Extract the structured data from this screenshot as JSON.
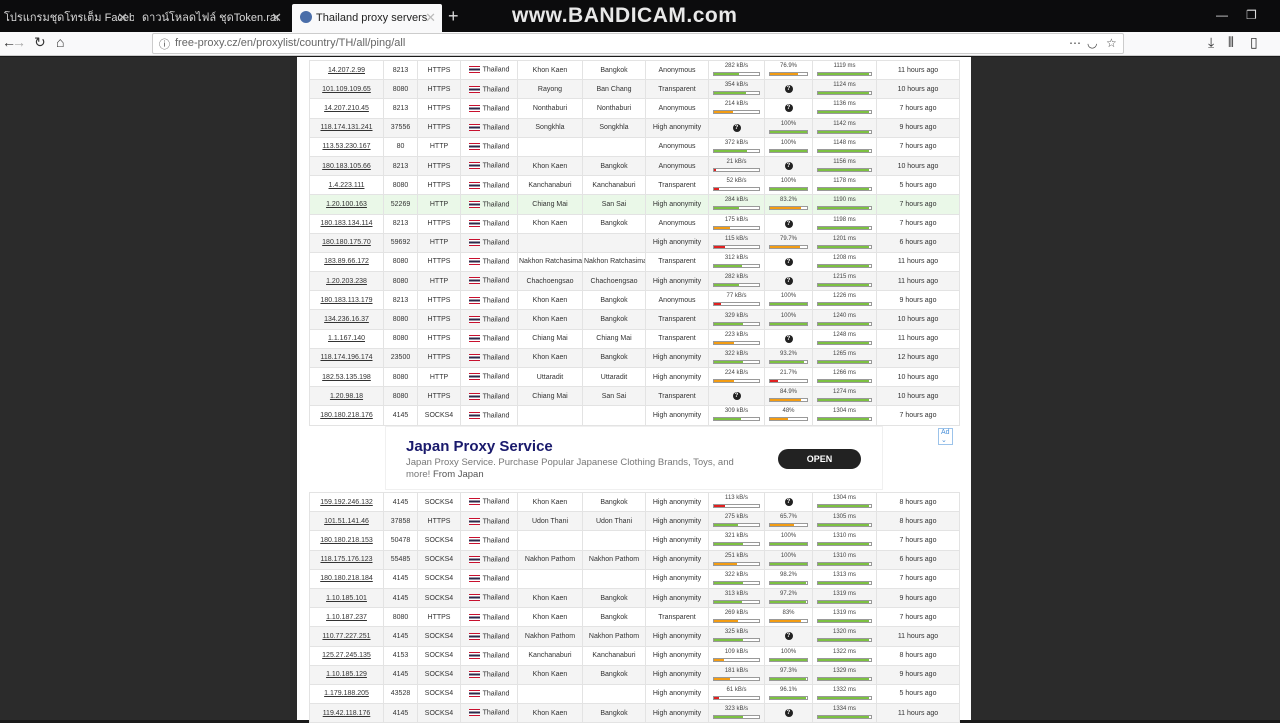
{
  "tabs": [
    {
      "label": "โปรแกรมชุดโทรเต็ม Facebook"
    },
    {
      "label": "ดาวน์โหลดไฟล์ ชุดToken.rar"
    },
    {
      "label": "Thailand proxy servers"
    }
  ],
  "watermark": "www.BANDICAM.com",
  "address_bar": {
    "url": "free-proxy.cz/en/proxylist/country/TH/all/ping/all"
  },
  "colors": {
    "green": "#7cc142",
    "orange": "#f39c12",
    "red": "#e02020"
  },
  "proxies_top": [
    {
      "ip": "14.207.2.99",
      "port": "8213",
      "protocol": "HTTPS",
      "country": "Thailand",
      "region": "Khon Kaen",
      "city": "Bangkok",
      "anonymity": "Anonymous",
      "speed": "282 kB/s",
      "speed_frac": 0.55,
      "speed_col": "green",
      "uptime": "76.9%",
      "uptime_frac": 0.77,
      "uptime_col": "orange",
      "response": "1119 ms",
      "checked": "11 hours ago"
    },
    {
      "ip": "101.109.109.65",
      "port": "8080",
      "protocol": "HTTPS",
      "country": "Thailand",
      "region": "Rayong",
      "city": "Ban Chang",
      "anonymity": "Transparent",
      "speed": "354 kB/s",
      "speed_frac": 0.7,
      "speed_col": "green",
      "uptime": "?",
      "response": "1124 ms",
      "checked": "10 hours ago"
    },
    {
      "ip": "14.207.210.45",
      "port": "8213",
      "protocol": "HTTPS",
      "country": "Thailand",
      "region": "Nonthaburi",
      "city": "Nonthaburi",
      "anonymity": "Anonymous",
      "speed": "214 kB/s",
      "speed_frac": 0.42,
      "speed_col": "orange",
      "uptime": "?",
      "response": "1136 ms",
      "checked": "7 hours ago"
    },
    {
      "ip": "118.174.131.241",
      "port": "37556",
      "protocol": "HTTPS",
      "country": "Thailand",
      "region": "Songkhla",
      "city": "Songkhla",
      "anonymity": "High anonymity",
      "speed": "?",
      "uptime": "100%",
      "uptime_frac": 1,
      "uptime_col": "green",
      "response": "1142 ms",
      "checked": "9 hours ago"
    },
    {
      "ip": "113.53.230.167",
      "port": "80",
      "protocol": "HTTP",
      "country": "Thailand",
      "region": "",
      "city": "",
      "anonymity": "Anonymous",
      "speed": "372 kB/s",
      "speed_frac": 0.74,
      "speed_col": "green",
      "uptime": "100%",
      "uptime_frac": 1,
      "uptime_col": "green",
      "response": "1148 ms",
      "checked": "7 hours ago"
    },
    {
      "ip": "180.183.105.66",
      "port": "8213",
      "protocol": "HTTPS",
      "country": "Thailand",
      "region": "Khon Kaen",
      "city": "Bangkok",
      "anonymity": "Anonymous",
      "speed": "21 kB/s",
      "speed_frac": 0.05,
      "speed_col": "red",
      "uptime": "?",
      "response": "1156 ms",
      "checked": "10 hours ago"
    },
    {
      "ip": "1.4.223.111",
      "port": "8080",
      "protocol": "HTTPS",
      "country": "Thailand",
      "region": "Kanchanaburi",
      "city": "Kanchanaburi",
      "anonymity": "Transparent",
      "speed": "52 kB/s",
      "speed_frac": 0.12,
      "speed_col": "red",
      "uptime": "100%",
      "uptime_frac": 1,
      "uptime_col": "green",
      "response": "1178 ms",
      "checked": "5 hours ago"
    },
    {
      "ip": "1.20.100.163",
      "port": "52269",
      "protocol": "HTTP",
      "country": "Thailand",
      "region": "Chiang Mai",
      "city": "San Sai",
      "anonymity": "High anonymity",
      "speed": "284 kB/s",
      "speed_frac": 0.56,
      "speed_col": "green",
      "uptime": "83.2%",
      "uptime_frac": 0.83,
      "uptime_col": "orange",
      "response": "1190 ms",
      "checked": "7 hours ago",
      "highlight": true
    },
    {
      "ip": "180.183.134.114",
      "port": "8213",
      "protocol": "HTTPS",
      "country": "Thailand",
      "region": "Khon Kaen",
      "city": "Bangkok",
      "anonymity": "Anonymous",
      "speed": "175 kB/s",
      "speed_frac": 0.35,
      "speed_col": "orange",
      "uptime": "?",
      "response": "1198 ms",
      "checked": "7 hours ago"
    },
    {
      "ip": "180.180.175.70",
      "port": "59692",
      "protocol": "HTTP",
      "country": "Thailand",
      "region": "",
      "city": "",
      "anonymity": "High anonymity",
      "speed": "115 kB/s",
      "speed_frac": 0.25,
      "speed_col": "red",
      "uptime": "79.7%",
      "uptime_frac": 0.8,
      "uptime_col": "orange",
      "response": "1201 ms",
      "checked": "6 hours ago"
    },
    {
      "ip": "183.89.66.172",
      "port": "8080",
      "protocol": "HTTPS",
      "country": "Thailand",
      "region": "Nakhon Ratchasima",
      "city": "Nakhon Ratchasima",
      "anonymity": "Transparent",
      "speed": "312 kB/s",
      "speed_frac": 0.62,
      "speed_col": "green",
      "uptime": "?",
      "response": "1208 ms",
      "checked": "11 hours ago"
    },
    {
      "ip": "1.20.203.238",
      "port": "8080",
      "protocol": "HTTP",
      "country": "Thailand",
      "region": "Chachoengsao",
      "city": "Chachoengsao",
      "anonymity": "High anonymity",
      "speed": "282 kB/s",
      "speed_frac": 0.55,
      "speed_col": "green",
      "uptime": "?",
      "response": "1215 ms",
      "checked": "11 hours ago"
    },
    {
      "ip": "180.183.113.179",
      "port": "8213",
      "protocol": "HTTPS",
      "country": "Thailand",
      "region": "Khon Kaen",
      "city": "Bangkok",
      "anonymity": "Anonymous",
      "speed": "77 kB/s",
      "speed_frac": 0.15,
      "speed_col": "red",
      "uptime": "100%",
      "uptime_frac": 1,
      "uptime_col": "green",
      "response": "1226 ms",
      "checked": "9 hours ago"
    },
    {
      "ip": "134.236.16.37",
      "port": "8080",
      "protocol": "HTTPS",
      "country": "Thailand",
      "region": "Khon Kaen",
      "city": "Bangkok",
      "anonymity": "Transparent",
      "speed": "329 kB/s",
      "speed_frac": 0.65,
      "speed_col": "green",
      "uptime": "100%",
      "uptime_frac": 1,
      "uptime_col": "green",
      "response": "1240 ms",
      "checked": "10 hours ago"
    },
    {
      "ip": "1.1.167.140",
      "port": "8080",
      "protocol": "HTTPS",
      "country": "Thailand",
      "region": "Chiang Mai",
      "city": "Chiang Mai",
      "anonymity": "Transparent",
      "speed": "223 kB/s",
      "speed_frac": 0.44,
      "speed_col": "orange",
      "uptime": "?",
      "response": "1248 ms",
      "checked": "11 hours ago"
    },
    {
      "ip": "118.174.196.174",
      "port": "23500",
      "protocol": "HTTPS",
      "country": "Thailand",
      "region": "Khon Kaen",
      "city": "Bangkok",
      "anonymity": "High anonymity",
      "speed": "322 kB/s",
      "speed_frac": 0.64,
      "speed_col": "green",
      "uptime": "93.2%",
      "uptime_frac": 0.93,
      "uptime_col": "green",
      "response": "1265 ms",
      "checked": "12 hours ago"
    },
    {
      "ip": "182.53.135.198",
      "port": "8080",
      "protocol": "HTTP",
      "country": "Thailand",
      "region": "Uttaradit",
      "city": "Uttaradit",
      "anonymity": "High anonymity",
      "speed": "224 kB/s",
      "speed_frac": 0.44,
      "speed_col": "orange",
      "uptime": "21.7%",
      "uptime_frac": 0.22,
      "uptime_col": "red",
      "response": "1266 ms",
      "checked": "10 hours ago"
    },
    {
      "ip": "1.20.98.18",
      "port": "8080",
      "protocol": "HTTPS",
      "country": "Thailand",
      "region": "Chiang Mai",
      "city": "San Sai",
      "anonymity": "Transparent",
      "speed": "?",
      "uptime": "84.9%",
      "uptime_frac": 0.85,
      "uptime_col": "orange",
      "response": "1274 ms",
      "checked": "10 hours ago"
    },
    {
      "ip": "180.180.218.176",
      "port": "4145",
      "protocol": "SOCKS4",
      "country": "Thailand",
      "region": "",
      "city": "",
      "anonymity": "High anonymity",
      "speed": "309 kB/s",
      "speed_frac": 0.61,
      "speed_col": "green",
      "uptime": "48%",
      "uptime_frac": 0.48,
      "uptime_col": "orange",
      "response": "1304 ms",
      "checked": "7 hours ago"
    }
  ],
  "ad": {
    "tag": "Ad ⌄",
    "title": "Japan Proxy Service",
    "desc": "Japan Proxy Service. Purchase Popular Japanese Clothing Brands, Toys, and more!",
    "source": "From Japan",
    "button": "OPEN"
  },
  "proxies_bottom": [
    {
      "ip": "159.192.246.132",
      "port": "4145",
      "protocol": "SOCKS4",
      "country": "Thailand",
      "region": "Khon Kaen",
      "city": "Bangkok",
      "anonymity": "High anonymity",
      "speed": "113 kB/s",
      "speed_frac": 0.24,
      "speed_col": "red",
      "uptime": "?",
      "response": "1304 ms",
      "checked": "8 hours ago"
    },
    {
      "ip": "101.51.141.46",
      "port": "37858",
      "protocol": "HTTPS",
      "country": "Thailand",
      "region": "Udon Thani",
      "city": "Udon Thani",
      "anonymity": "High anonymity",
      "speed": "275 kB/s",
      "speed_frac": 0.54,
      "speed_col": "green",
      "uptime": "65.7%",
      "uptime_frac": 0.66,
      "uptime_col": "orange",
      "response": "1305 ms",
      "checked": "8 hours ago"
    },
    {
      "ip": "180.180.218.153",
      "port": "50478",
      "protocol": "SOCKS4",
      "country": "Thailand",
      "region": "",
      "city": "",
      "anonymity": "High anonymity",
      "speed": "321 kB/s",
      "speed_frac": 0.64,
      "speed_col": "green",
      "uptime": "100%",
      "uptime_frac": 1,
      "uptime_col": "green",
      "response": "1310 ms",
      "checked": "7 hours ago"
    },
    {
      "ip": "118.175.176.123",
      "port": "55485",
      "protocol": "SOCKS4",
      "country": "Thailand",
      "region": "Nakhon Pathom",
      "city": "Nakhon Pathom",
      "anonymity": "High anonymity",
      "speed": "251 kB/s",
      "speed_frac": 0.5,
      "speed_col": "orange",
      "uptime": "100%",
      "uptime_frac": 1,
      "uptime_col": "green",
      "response": "1310 ms",
      "checked": "6 hours ago"
    },
    {
      "ip": "180.180.218.184",
      "port": "4145",
      "protocol": "SOCKS4",
      "country": "Thailand",
      "region": "",
      "city": "",
      "anonymity": "High anonymity",
      "speed": "322 kB/s",
      "speed_frac": 0.64,
      "speed_col": "green",
      "uptime": "98.2%",
      "uptime_frac": 0.98,
      "uptime_col": "green",
      "response": "1313 ms",
      "checked": "7 hours ago"
    },
    {
      "ip": "1.10.185.101",
      "port": "4145",
      "protocol": "SOCKS4",
      "country": "Thailand",
      "region": "Khon Kaen",
      "city": "Bangkok",
      "anonymity": "High anonymity",
      "speed": "313 kB/s",
      "speed_frac": 0.62,
      "speed_col": "green",
      "uptime": "97.2%",
      "uptime_frac": 0.97,
      "uptime_col": "green",
      "response": "1319 ms",
      "checked": "9 hours ago"
    },
    {
      "ip": "1.10.187.237",
      "port": "8080",
      "protocol": "HTTPS",
      "country": "Thailand",
      "region": "Khon Kaen",
      "city": "Bangkok",
      "anonymity": "Transparent",
      "speed": "269 kB/s",
      "speed_frac": 0.53,
      "speed_col": "orange",
      "uptime": "83%",
      "uptime_frac": 0.83,
      "uptime_col": "orange",
      "response": "1319 ms",
      "checked": "7 hours ago"
    },
    {
      "ip": "110.77.227.251",
      "port": "4145",
      "protocol": "SOCKS4",
      "country": "Thailand",
      "region": "Nakhon Pathom",
      "city": "Nakhon Pathom",
      "anonymity": "High anonymity",
      "speed": "325 kB/s",
      "speed_frac": 0.65,
      "speed_col": "green",
      "uptime": "?",
      "response": "1320 ms",
      "checked": "11 hours ago"
    },
    {
      "ip": "125.27.245.135",
      "port": "4153",
      "protocol": "SOCKS4",
      "country": "Thailand",
      "region": "Kanchanaburi",
      "city": "Kanchanaburi",
      "anonymity": "High anonymity",
      "speed": "109 kB/s",
      "speed_frac": 0.22,
      "speed_col": "orange",
      "uptime": "100%",
      "uptime_frac": 1,
      "uptime_col": "green",
      "response": "1322 ms",
      "checked": "8 hours ago"
    },
    {
      "ip": "1.10.185.129",
      "port": "4145",
      "protocol": "SOCKS4",
      "country": "Thailand",
      "region": "Khon Kaen",
      "city": "Bangkok",
      "anonymity": "High anonymity",
      "speed": "181 kB/s",
      "speed_frac": 0.36,
      "speed_col": "orange",
      "uptime": "97.3%",
      "uptime_frac": 0.97,
      "uptime_col": "green",
      "response": "1329 ms",
      "checked": "9 hours ago"
    },
    {
      "ip": "1.179.188.205",
      "port": "43528",
      "protocol": "SOCKS4",
      "country": "Thailand",
      "region": "",
      "city": "",
      "anonymity": "High anonymity",
      "speed": "61 kB/s",
      "speed_frac": 0.12,
      "speed_col": "red",
      "uptime": "96.1%",
      "uptime_frac": 0.96,
      "uptime_col": "green",
      "response": "1332 ms",
      "checked": "5 hours ago"
    },
    {
      "ip": "119.42.118.176",
      "port": "4145",
      "protocol": "SOCKS4",
      "country": "Thailand",
      "region": "Khon Kaen",
      "city": "Bangkok",
      "anonymity": "High anonymity",
      "speed": "323 kB/s",
      "speed_frac": 0.64,
      "speed_col": "green",
      "uptime": "?",
      "response": "1334 ms",
      "checked": "11 hours ago"
    }
  ]
}
